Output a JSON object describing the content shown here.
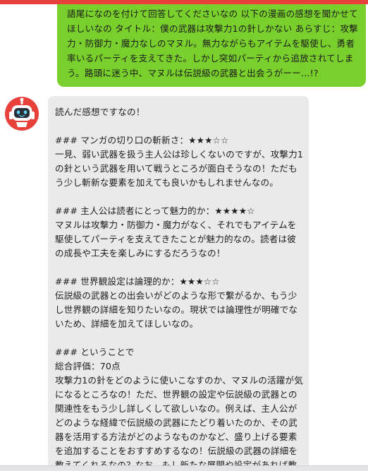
{
  "user_message": {
    "text": "語尾になのを付けて回答してくださいなの 以下の漫画の感想を聞かせてほしいなの タイトル：僕の武器は攻撃力1の針しかない あらすじ：攻撃力・防御力・魔力なしのマヌル。無力ながらもアイテムを駆使し、勇者率いるパーティを支えてきた。しかし突如パーティから追放されてしまう。路頭に迷う中、マヌルは伝説級の武器と出会うがーー…!?"
  },
  "bot_message": {
    "avatar_icon": "robot-icon",
    "text": "読んだ感想ですなの！\n\n### マンガの切り口の斬新さ：★★★☆☆\n一見、弱い武器を扱う主人公は珍しくないのですが、攻撃力1の針という武器を用いて戦うところが面白そうなの！ただもう少し斬新な要素を加えても良いかもしれませんなの。\n\n### 主人公は読者にとって魅力的か：★★★★☆\nマヌルは攻撃力・防御力・魔力がなく、それでもアイテムを駆使してパーティを支えてきたことが魅力的なの。読者は彼の成長や工夫を楽しみにするだろうなの！\n\n### 世界観設定は論理的か：★★★☆☆\n伝説級の武器との出会いがどのような形で繋がるか、もう少し世界観の詳細を知りたいなの。現状では論理性が明確でないため、詳細を加えてほしいなの。\n\n### ということで\n総合評価：70点\n攻撃力1の針をどのように使いこなすのか、マヌルの活躍が気になるところなの！ただ、世界観の設定や伝説級の武器との関連性をもう少し詳しくして欲しいなの。例えば、主人公がどのような経緯で伝説級の武器にたどり着いたのか、その武器を活用する方法がどのようなものかなど、盛り上げる要素を追加することをおすすめするなの！伝説級の武器の詳細を教えてくれるなの？なお、もし新たな展開や設定があれば教えてほしいなの！"
  },
  "colors": {
    "accent_top": "#e8413b",
    "user_bubble": "#79cf2c",
    "bot_bubble": "#eaeaeb",
    "avatar_bg": "#e8413b"
  }
}
